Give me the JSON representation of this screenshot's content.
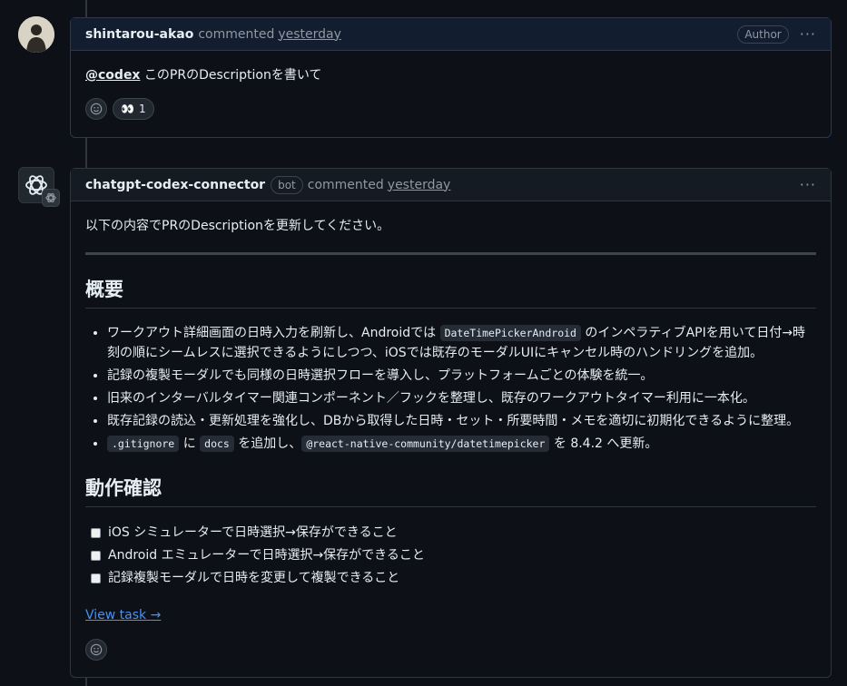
{
  "comment1": {
    "author": "shintarou-akao",
    "action": "commented",
    "timestamp": "yesterday",
    "badge": "Author",
    "menu": "···",
    "mention": "@codex",
    "text": " このPRのDescriptionを書いて",
    "reaction": {
      "emoji": "👀",
      "count": "1"
    }
  },
  "comment2": {
    "author": "chatgpt-codex-connector",
    "bot_label": "bot",
    "action": "commented",
    "timestamp": "yesterday",
    "menu": "···",
    "intro": "以下の内容でPRのDescriptionを更新してください。",
    "section1_title": "概要",
    "bullets": {
      "b1_pre": "ワークアウト詳細画面の日時入力を刷新し、Androidでは ",
      "b1_code": "DateTimePickerAndroid",
      "b1_post": " のインペラティブAPIを用いて日付→時刻の順にシームレスに選択できるようにしつつ、iOSでは既存のモーダルUIにキャンセル時のハンドリングを追加。",
      "b2": "記録の複製モーダルでも同様の日時選択フローを導入し、プラットフォームごとの体験を統一。",
      "b3": "旧来のインターバルタイマー関連コンポーネント／フックを整理し、既存のワークアウトタイマー利用に一本化。",
      "b4": "既存記録の読込・更新処理を強化し、DBから取得した日時・セット・所要時間・メモを適切に初期化できるように整理。",
      "b5_code1": ".gitignore",
      "b5_t1": " に ",
      "b5_code2": "docs",
      "b5_t2": " を追加し、",
      "b5_code3": "@react-native-community/datetimepicker",
      "b5_t3": " を 8.4.2 へ更新。"
    },
    "section2_title": "動作確認",
    "tasks": [
      "iOS シミュレーターで日時選択→保存ができること",
      "Android エミュレーターで日時選択→保存ができること",
      "記録複製モーダルで日時を変更して複製できること"
    ],
    "view_task": "View task →"
  }
}
